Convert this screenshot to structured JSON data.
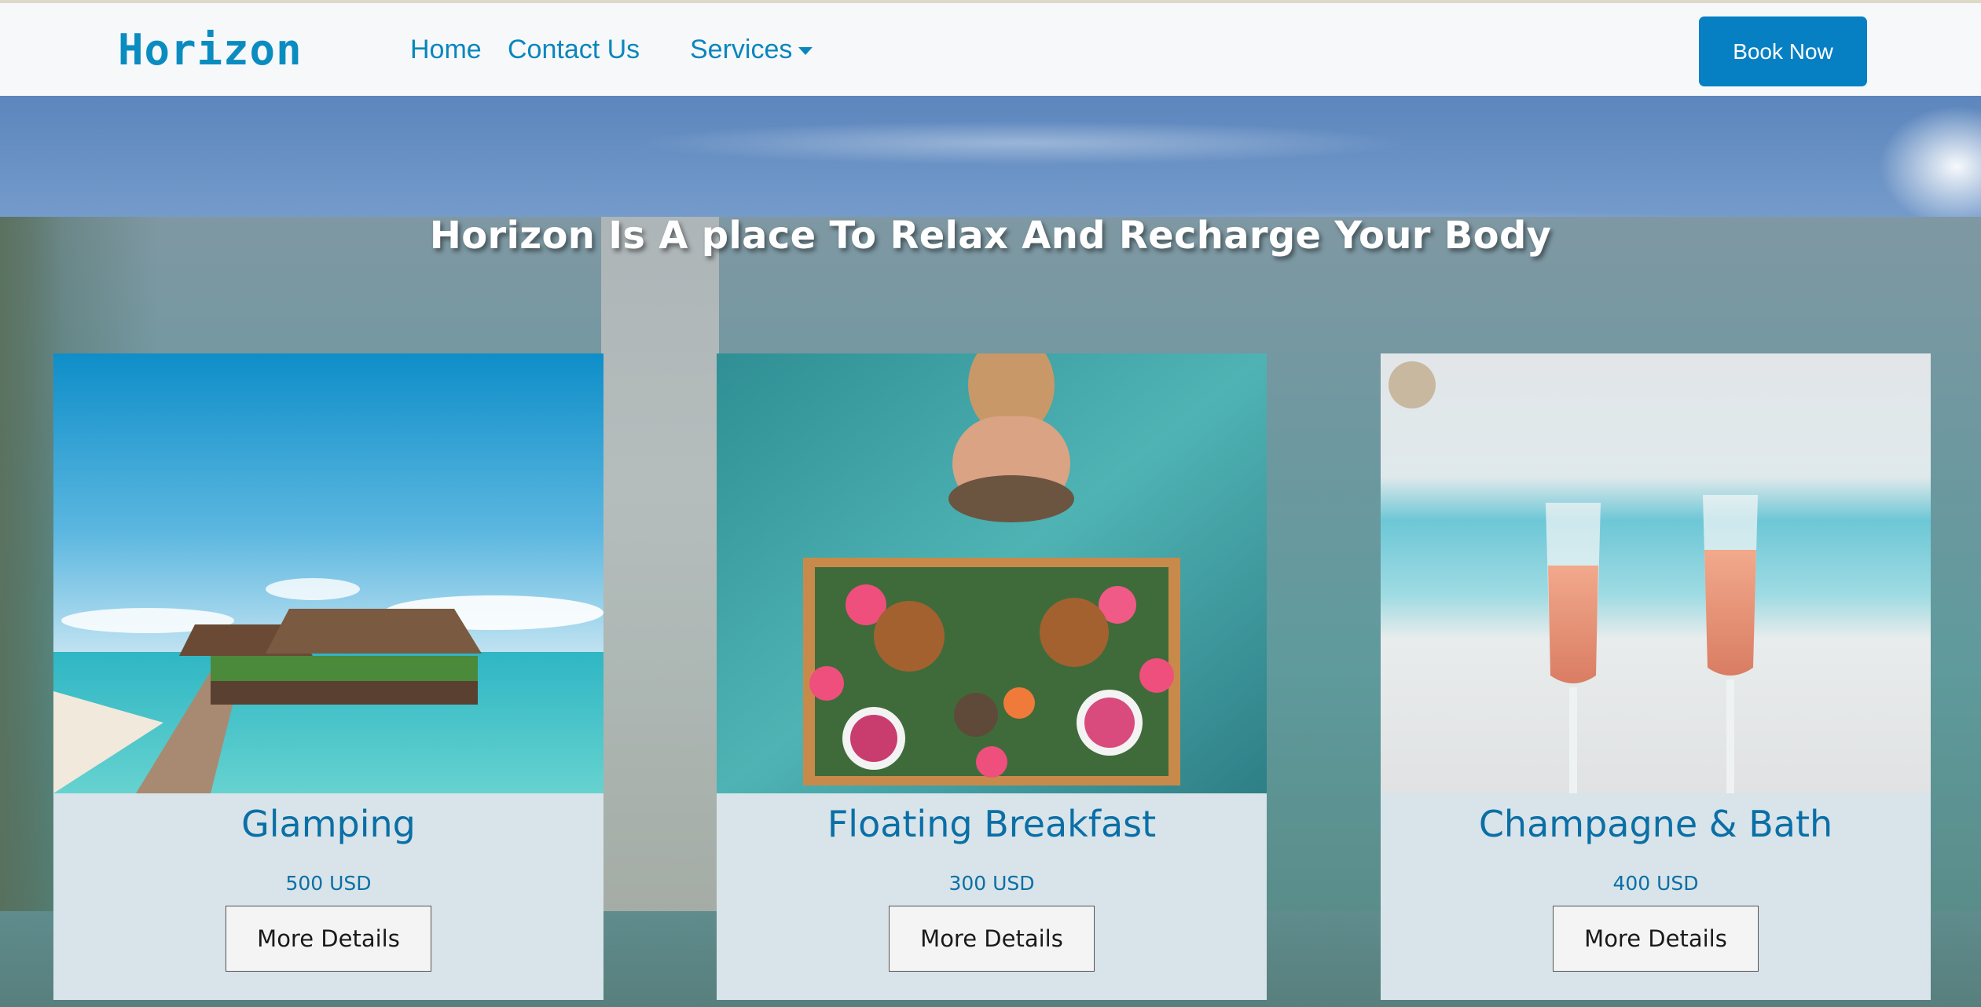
{
  "navbar": {
    "brand": "Horizon",
    "links": [
      {
        "label": "Home"
      },
      {
        "label": "Contact Us"
      },
      {
        "label": "Services"
      }
    ],
    "cta_label": "Book Now"
  },
  "hero": {
    "title": "Horizon Is A place To Relax And Recharge Your Body"
  },
  "cards": [
    {
      "title": "Glamping",
      "price": "500 USD",
      "button_label": "More Details",
      "image": "overwater-bungalow-pier-photo"
    },
    {
      "title": "Floating Breakfast",
      "price": "300 USD",
      "button_label": "More Details",
      "image": "floating-breakfast-pool-photo"
    },
    {
      "title": "Champagne & Bath",
      "price": "400 USD",
      "button_label": "More Details",
      "image": "champagne-glasses-beach-photo"
    }
  ],
  "colors": {
    "brand": "#0a8cc0",
    "nav_link": "#0a86bd",
    "cta_bg": "#0780c3",
    "card_bg": "#d8e4e9",
    "card_text": "#0b6fa6"
  }
}
